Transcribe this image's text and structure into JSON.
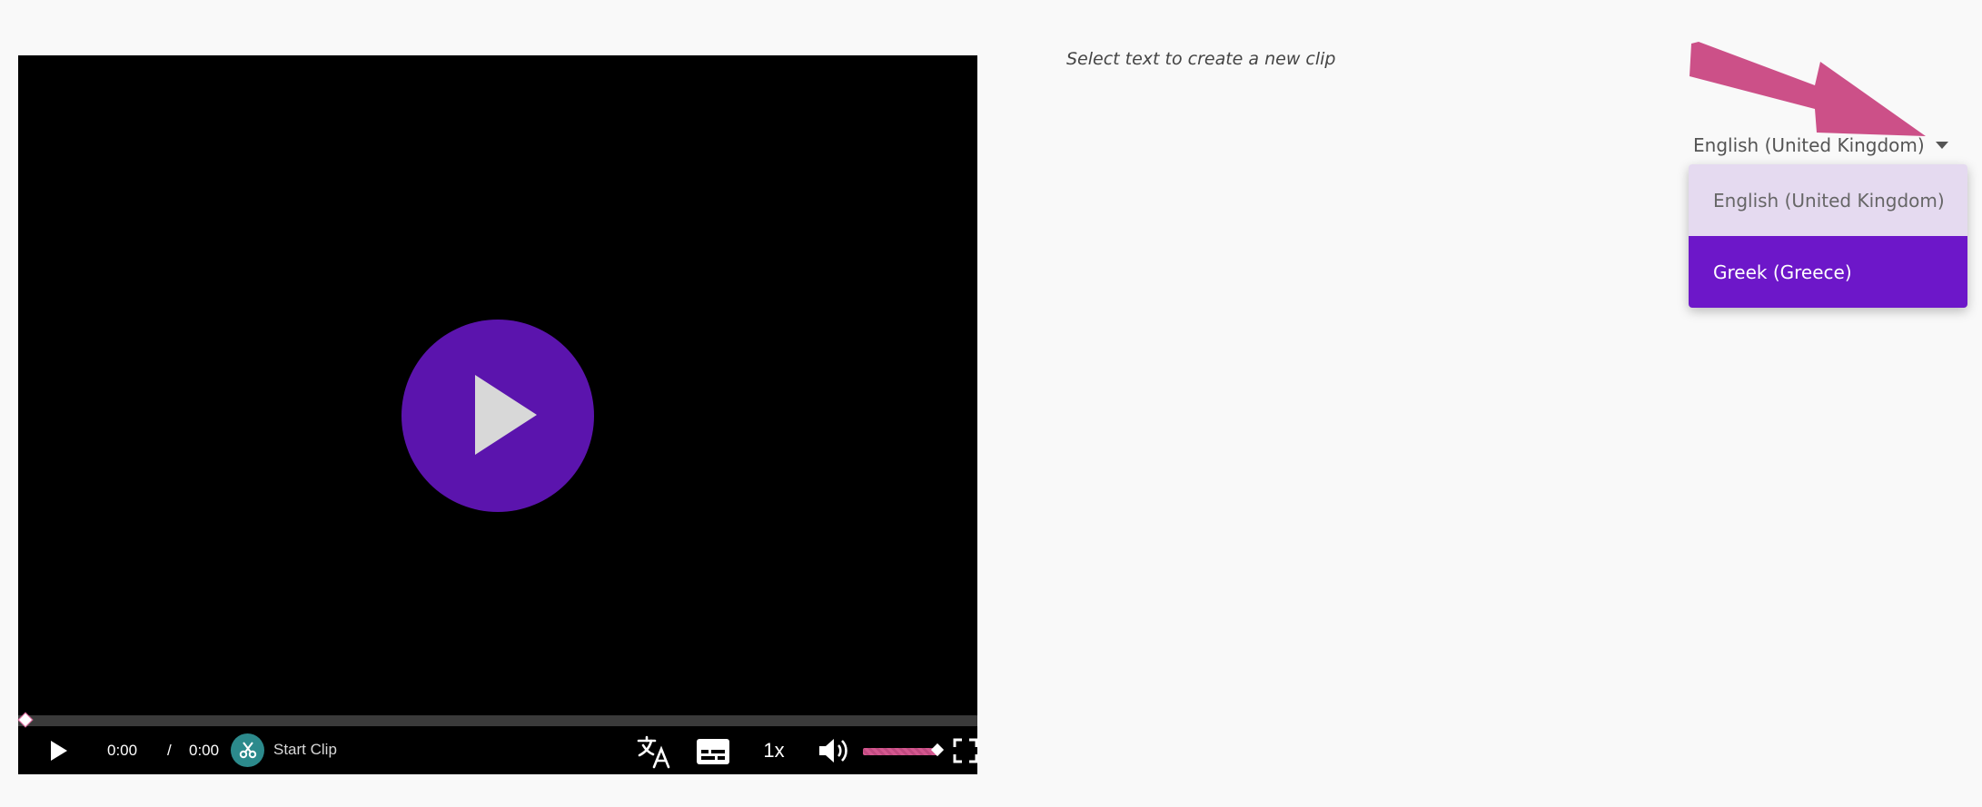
{
  "player": {
    "current_time": "0:00",
    "separator": "/",
    "duration": "0:00",
    "clip_label": "Start Clip",
    "speed": "1x",
    "progress": 0,
    "volume": 1.0,
    "colors": {
      "play_circle": "#5b14ad",
      "accent": "#d4578f",
      "clip_icon_bg": "#2c8a8c"
    }
  },
  "panel": {
    "hint": "Select text to create a new clip",
    "language_selected": "English (United Kingdom)",
    "language_options": [
      "English (United Kingdom)",
      "Greek (Greece)"
    ],
    "highlighted_option": "Greek (Greece)"
  },
  "icons": {
    "big_play": "play-icon",
    "play": "play-icon",
    "clip": "scissors-icon",
    "translate": "translate-icon",
    "subtitles": "subtitles-icon",
    "volume": "volume-icon",
    "fullscreen": "fullscreen-icon",
    "dropdown": "caret-down-icon",
    "annotation": "arrow-annotation"
  }
}
